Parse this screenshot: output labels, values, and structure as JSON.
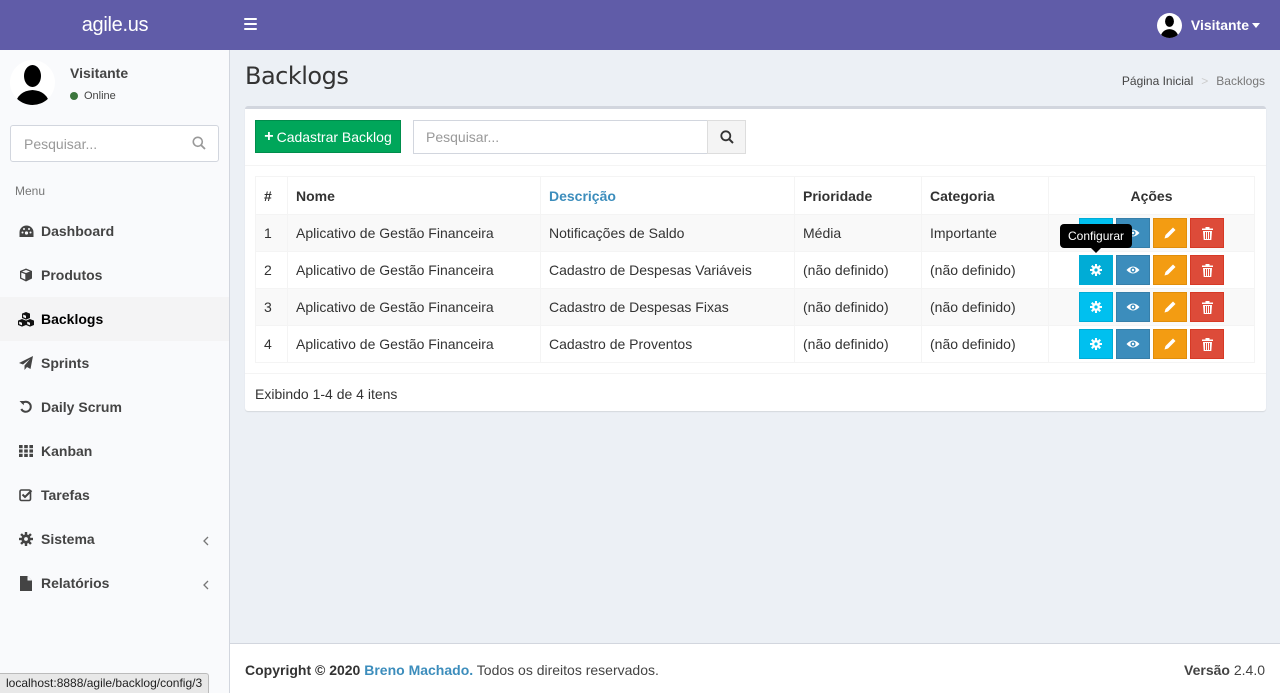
{
  "app": {
    "logo": "agile.us"
  },
  "header": {
    "user_name": "Visitante"
  },
  "sidebar": {
    "user_name": "Visitante",
    "user_status": "Online",
    "search_placeholder": "Pesquisar...",
    "menu_header": "Menu",
    "items": [
      {
        "label": "Dashboard",
        "icon": "dashboard-icon"
      },
      {
        "label": "Produtos",
        "icon": "cube-icon"
      },
      {
        "label": "Backlogs",
        "icon": "cubes-icon",
        "active": true
      },
      {
        "label": "Sprints",
        "icon": "paper-plane-icon"
      },
      {
        "label": "Daily Scrum",
        "icon": "rotate-icon"
      },
      {
        "label": "Kanban",
        "icon": "grid-icon"
      },
      {
        "label": "Tarefas",
        "icon": "checkbox-icon"
      },
      {
        "label": "Sistema",
        "icon": "gear-icon",
        "has_submenu": true
      },
      {
        "label": "Relatórios",
        "icon": "file-icon",
        "has_submenu": true
      }
    ]
  },
  "page": {
    "title": "Backlogs",
    "breadcrumb": [
      "Página Inicial",
      "Backlogs"
    ]
  },
  "toolbar": {
    "new_button": "Cadastrar Backlog",
    "search_placeholder": "Pesquisar..."
  },
  "table": {
    "columns": [
      "#",
      "Nome",
      "Descrição",
      "Prioridade",
      "Categoria",
      "Ações"
    ],
    "sortable_column": "Descrição",
    "rows": [
      {
        "id": "1",
        "nome": "Aplicativo de Gestão Financeira",
        "descricao": "Notificações de Saldo",
        "prioridade": "Média",
        "categoria": "Importante"
      },
      {
        "id": "2",
        "nome": "Aplicativo de Gestão Financeira",
        "descricao": "Cadastro de Despesas Variáveis",
        "prioridade": "(não definido)",
        "categoria": "(não definido)"
      },
      {
        "id": "3",
        "nome": "Aplicativo de Gestão Financeira",
        "descricao": "Cadastro de Despesas Fixas",
        "prioridade": "(não definido)",
        "categoria": "(não definido)"
      },
      {
        "id": "4",
        "nome": "Aplicativo de Gestão Financeira",
        "descricao": "Cadastro de Proventos",
        "prioridade": "(não definido)",
        "categoria": "(não definido)"
      }
    ],
    "actions": [
      "config",
      "view",
      "edit",
      "delete"
    ],
    "tooltip": "Configurar",
    "summary": "Exibindo 1-4 de 4 itens"
  },
  "footer": {
    "copyright_prefix": "Copyright © 2020",
    "author": "Breno Machado.",
    "rights": "Todos os direitos reservados.",
    "version_label": "Versão",
    "version": "2.4.0"
  },
  "browser_status": "localhost:8888/agile/backlog/config/3",
  "colors": {
    "header": "#605ca8",
    "success": "#00a65a",
    "info": "#00c0ef",
    "primary": "#3c8dbc",
    "warning": "#f39c12",
    "danger": "#dd4b39"
  }
}
